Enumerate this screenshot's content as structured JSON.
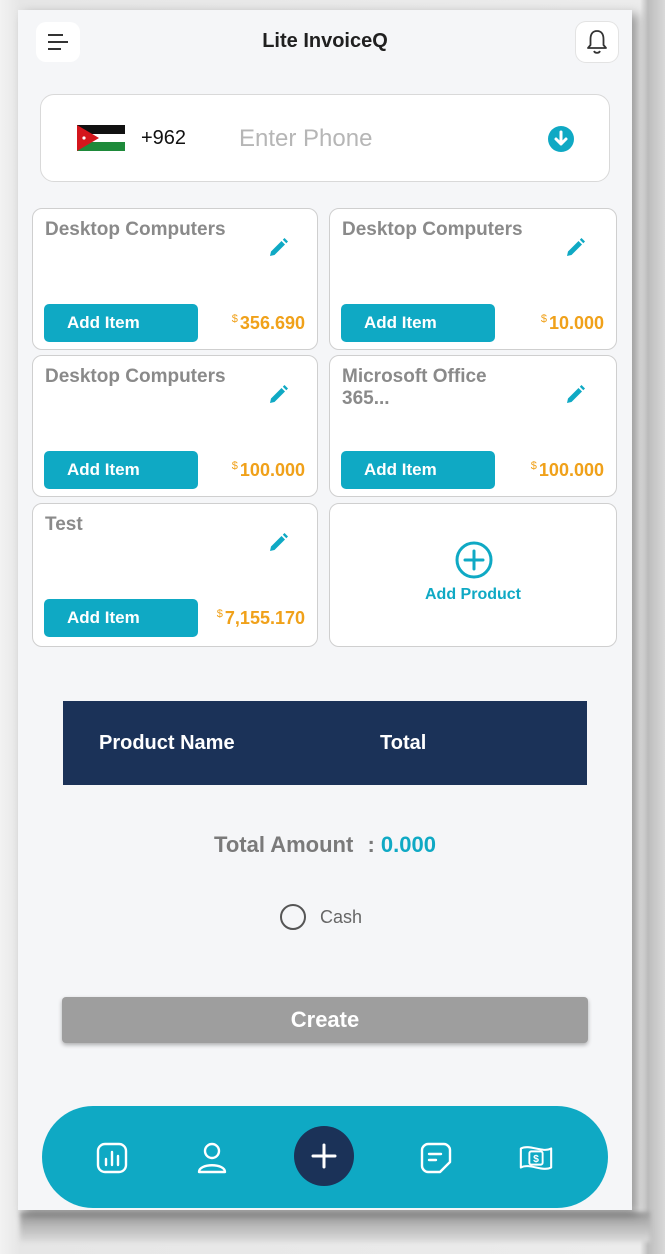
{
  "header": {
    "title": "Lite InvoiceQ",
    "menu_icon": "menu-icon",
    "bell_icon": "bell-icon"
  },
  "phone": {
    "country_code": "+962",
    "placeholder": "Enter Phone",
    "value": "",
    "flag": "jordan-flag-icon"
  },
  "products": [
    {
      "name": "Desktop Computers",
      "button": "Add Item",
      "currency": "$",
      "price": "356.690"
    },
    {
      "name": "Desktop Computers",
      "button": "Add Item",
      "currency": "$",
      "price": "10.000"
    },
    {
      "name": "Desktop Computers",
      "button": "Add Item",
      "currency": "$",
      "price": "100.000"
    },
    {
      "name": "Microsoft Office 365...",
      "button": "Add Item",
      "currency": "$",
      "price": "100.000"
    },
    {
      "name": "Test",
      "button": "Add Item",
      "currency": "$",
      "price": "7,155.170"
    }
  ],
  "add_product": {
    "label": "Add Product"
  },
  "table": {
    "col_name": "Product Name",
    "col_total": "Total"
  },
  "totals": {
    "label": "Total Amount",
    "separator": ":",
    "value": "0.000"
  },
  "payment": {
    "cash_label": "Cash",
    "cash_selected": false
  },
  "create_label": "Create",
  "nav": [
    "reports-icon",
    "user-icon",
    "plus-icon",
    "invoice-icon",
    "money-icon"
  ],
  "colors": {
    "accent": "#0fa9c4",
    "navy": "#1b3258",
    "price": "#f0a11a"
  }
}
